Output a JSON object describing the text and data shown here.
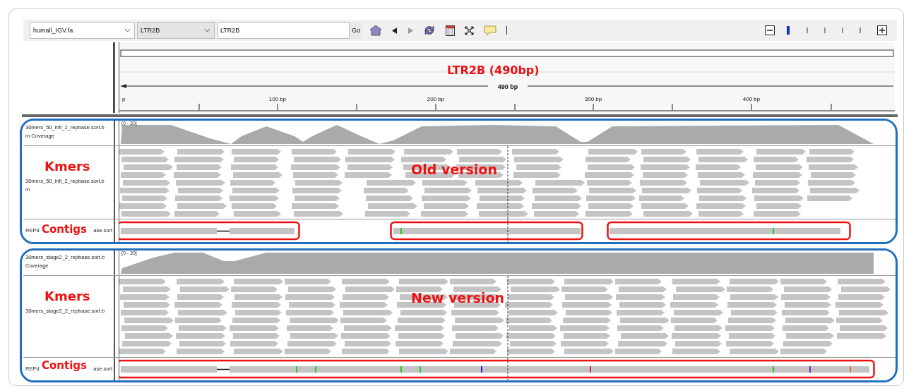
{
  "toolbar": {
    "genome": "humall_IGV.fa",
    "chromosome": "LTR2B",
    "locus": "LTR2B",
    "go": "Go",
    "zoom": {
      "level": 0
    }
  },
  "ruler": {
    "title": "LTR2B (490bp)",
    "span": "490 bp",
    "ticks": [
      "p",
      "100 bp",
      "200 bp",
      "300 bp",
      "400 bp"
    ]
  },
  "panels": [
    {
      "kmers_label": "Kmers",
      "contigs_label": "Contigs",
      "version_label": "Old version",
      "coverage": {
        "name_lines": [
          "30mers_50_infi_2_repbase.sort.b",
          "m Coverage"
        ],
        "range": "[0 - 30]"
      },
      "alignment": {
        "name_lines": [
          "30mers_50_infi_2_repbase.sort.b",
          "m"
        ]
      },
      "contigs": {
        "name_start": "REPd",
        "name_end": "ase.sort"
      }
    },
    {
      "kmers_label": "Kmers",
      "contigs_label": "Contigs",
      "version_label": "New version",
      "coverage": {
        "name_lines": [
          "30mers_stage2_2_repbase.sort.b",
          "Coverage"
        ],
        "range": "[0 - 30]"
      },
      "alignment": {
        "name_lines": [
          "30mers_stage2_2_repbase.sort.b"
        ]
      },
      "contigs": {
        "name_start": "REPd",
        "name_end": "ase.sort"
      }
    }
  ]
}
